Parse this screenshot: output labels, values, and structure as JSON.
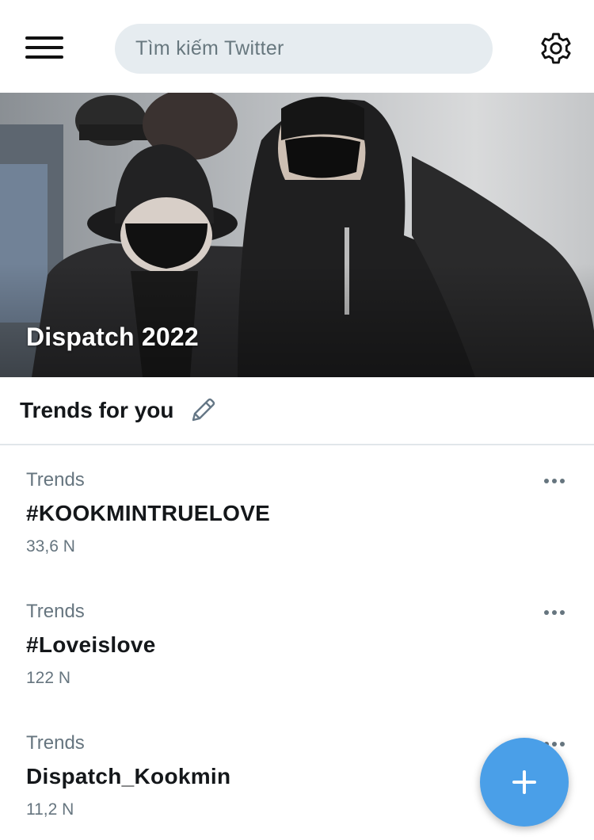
{
  "header": {
    "menu_icon": "hamburger-menu-icon",
    "search": {
      "placeholder": "Tìm kiếm Twitter"
    },
    "settings_icon": "gear-icon"
  },
  "hero": {
    "title": "Dispatch 2022"
  },
  "trends": {
    "title": "Trends for you",
    "edit_icon": "pencil-icon",
    "items": [
      {
        "context": "Trends",
        "name": "#KOOKMINTRUELOVE",
        "count": "33,6 N"
      },
      {
        "context": "Trends",
        "name": "#Loveislove",
        "count": "122 N"
      },
      {
        "context": "Trends",
        "name": "Dispatch_Kookmin",
        "count": "11,2 N"
      }
    ]
  },
  "fab": {
    "icon": "plus-icon"
  },
  "colors": {
    "accent": "#4a9fe8",
    "search_bg": "#e6ecf0",
    "secondary_text": "#66757f",
    "primary_text": "#14171a"
  }
}
